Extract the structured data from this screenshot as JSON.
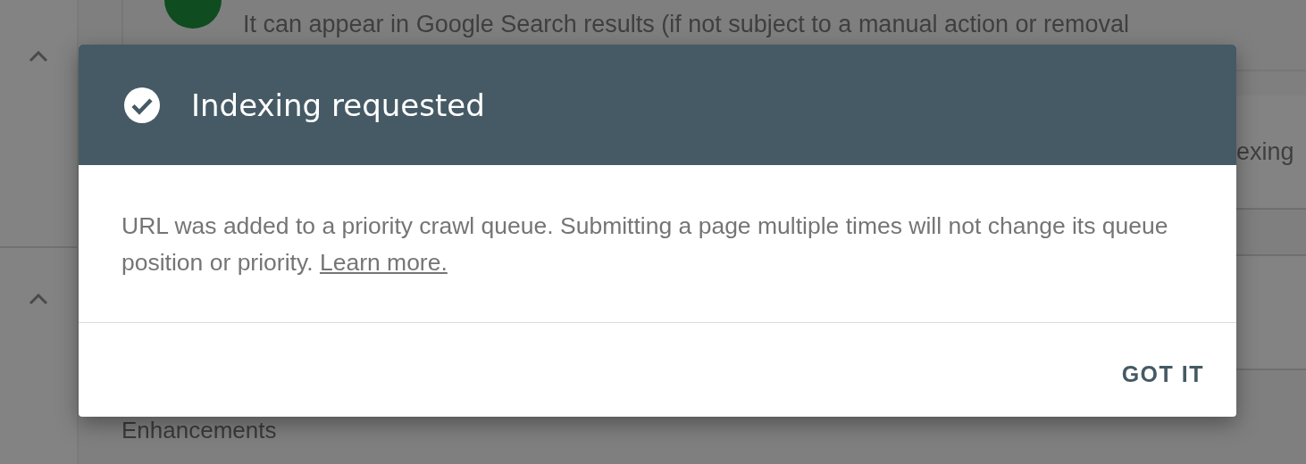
{
  "background": {
    "status_text": "It can appear in Google Search results (if not subject to a manual action or removal",
    "side_card_text": "exing",
    "section_heading": "Enhancements"
  },
  "dialog": {
    "title": "Indexing requested",
    "message": "URL was added to a priority crawl queue. Submitting a page multiple times will not change its queue position or priority.",
    "link": "Learn more.",
    "buttons": [
      "GOT IT"
    ]
  }
}
